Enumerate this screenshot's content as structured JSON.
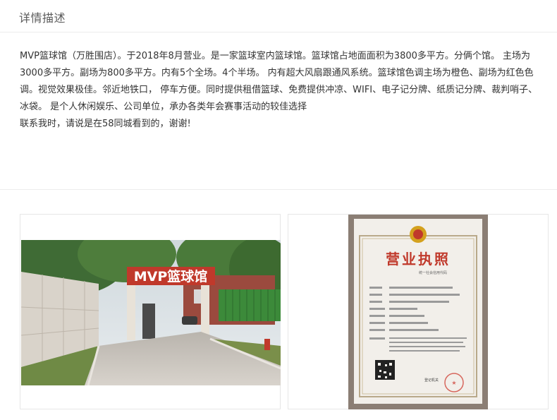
{
  "section": {
    "title": "详情描述"
  },
  "description": {
    "paragraph_1": "MVP篮球馆（万胜围店）。于2018年8月营业。是一家篮球室内篮球馆。篮球馆占地面面积为3800多平方。分俩个馆。 主场为3000多平方。副场为800多平方。内有5个全场。4个半场。 内有超大风扇跟通风系统。篮球馆色调主场为橙色、副场为红色色调。视觉效果极佳。邻近地铁口，  停车方便。同时提供租借篮球、免费提供冲凉、WIFI、电子记分牌、纸质记分牌、裁判哨子、冰袋。 是个人休闲娱乐、公司单位，承办各类年会赛事活动的较佳选择",
    "paragraph_2": "联系我时，请说是在58同城看到的，谢谢!"
  },
  "photos": {
    "venue_sign": "MVP篮球馆",
    "license_title": "营业执照",
    "license_small": "统一社会信用代码",
    "license_footer": "登记机关"
  },
  "colors": {
    "sign_red": "#c0392b",
    "license_title_red": "#c0392b"
  }
}
